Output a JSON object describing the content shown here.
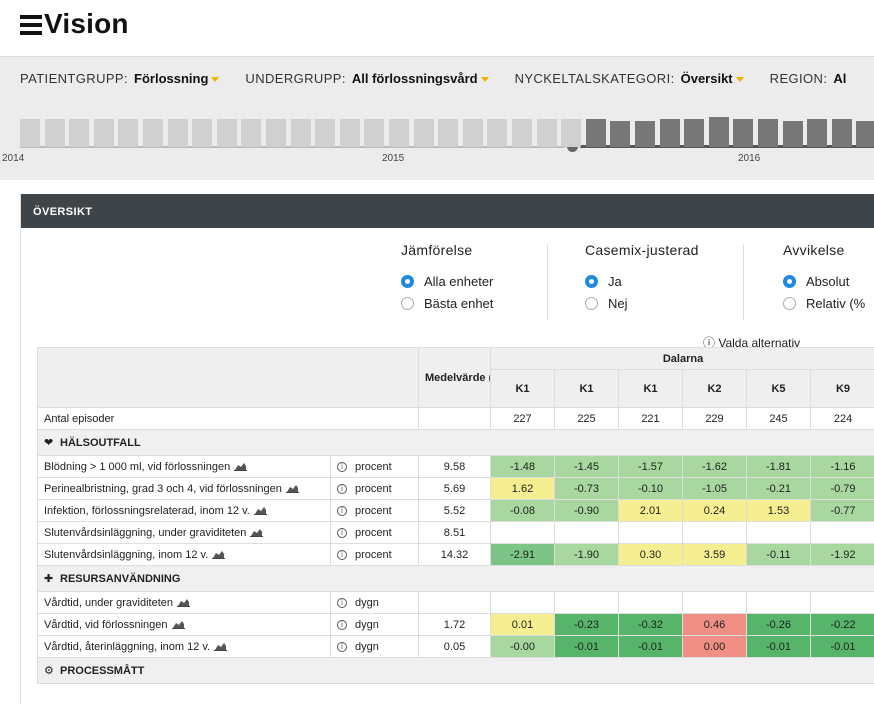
{
  "app": {
    "title": "Vision"
  },
  "filters": [
    {
      "label": "PATIENTGRUPP:",
      "value": "Förlossning"
    },
    {
      "label": "UNDERGRUPP:",
      "value": "All förlossningsvård"
    },
    {
      "label": "NYCKELTALSKATEGORI:",
      "value": "Översikt"
    },
    {
      "label": "REGION:",
      "value": "Al"
    }
  ],
  "timeline": {
    "years": [
      "2014",
      "2015",
      "2016"
    ]
  },
  "panel": {
    "title": "ÖVERSIKT"
  },
  "options": {
    "jamforelse": {
      "title": "Jämförelse",
      "items": [
        {
          "label": "Alla enheter",
          "selected": true
        },
        {
          "label": "Bästa enhet",
          "selected": false
        }
      ]
    },
    "casemix": {
      "title": "Casemix-justerad",
      "items": [
        {
          "label": "Ja",
          "selected": true
        },
        {
          "label": "Nej",
          "selected": false
        }
      ]
    },
    "avvikelse": {
      "title": "Avvikelse",
      "items": [
        {
          "label": "Absolut",
          "selected": true
        },
        {
          "label": "Relativ (%",
          "selected": false
        }
      ]
    },
    "valda": "ⓘ Valda alternativ"
  },
  "table": {
    "mean_header": "Medelvärde (alla enheter)",
    "group_header": "Dalarna",
    "columns": [
      "K1",
      "K1",
      "K1",
      "K2",
      "K5",
      "K9"
    ],
    "episodes": {
      "label": "Antal episoder",
      "values": [
        "227",
        "225",
        "221",
        "229",
        "245",
        "224"
      ]
    },
    "sections": [
      {
        "title": "HÄLSOUTFALL",
        "icon": "heart-icon",
        "rows": [
          {
            "name": "Blödning > 1 000 ml, vid förlossningen",
            "unit": "procent",
            "mean": "9.58",
            "values": [
              "-1.48",
              "-1.45",
              "-1.57",
              "-1.62",
              "-1.81",
              "-1.16"
            ],
            "colors": [
              "g1",
              "g1",
              "g1",
              "g1",
              "g1",
              "g1"
            ]
          },
          {
            "name": "Perinealbristning, grad 3 och 4, vid förlossningen",
            "unit": "procent",
            "mean": "5.69",
            "values": [
              "1.62",
              "-0.73",
              "-0.10",
              "-1.05",
              "-0.21",
              "-0.79"
            ],
            "colors": [
              "y",
              "g1",
              "g1",
              "g1",
              "g1",
              "g1"
            ]
          },
          {
            "name": "Infektion, förlossningsrelaterad, inom 12 v.",
            "unit": "procent",
            "mean": "5.52",
            "values": [
              "-0.08",
              "-0.90",
              "2.01",
              "0.24",
              "1.53",
              "-0.77"
            ],
            "colors": [
              "g1",
              "g1",
              "y",
              "y",
              "y",
              "g1"
            ]
          },
          {
            "name": "Slutenvårdsinläggning, under graviditeten",
            "unit": "procent",
            "mean": "8.51",
            "values": [
              "",
              "",
              "",
              "",
              "",
              ""
            ],
            "colors": [
              "",
              "",
              "",
              "",
              "",
              ""
            ]
          },
          {
            "name": "Slutenvårdsinläggning, inom 12 v.",
            "unit": "procent",
            "mean": "14.32",
            "values": [
              "-2.91",
              "-1.90",
              "0.30",
              "3.59",
              "-0.11",
              "-1.92"
            ],
            "colors": [
              "g2",
              "g1",
              "y",
              "y",
              "g1",
              "g1"
            ]
          }
        ]
      },
      {
        "title": "RESURSANVÄNDNING",
        "icon": "puzzle-icon",
        "rows": [
          {
            "name": "Vårdtid, under graviditeten",
            "unit": "dygn",
            "mean": "",
            "values": [
              "",
              "",
              "",
              "",
              "",
              ""
            ],
            "colors": [
              "",
              "",
              "",
              "",
              "",
              ""
            ]
          },
          {
            "name": "Vårdtid, vid förlossningen",
            "unit": "dygn",
            "mean": "1.72",
            "values": [
              "0.01",
              "-0.23",
              "-0.32",
              "0.46",
              "-0.26",
              "-0.22"
            ],
            "colors": [
              "y",
              "g3",
              "g3",
              "r",
              "g3",
              "g3"
            ]
          },
          {
            "name": "Vårdtid, återinläggning, inom 12 v.",
            "unit": "dygn",
            "mean": "0.05",
            "values": [
              "-0.00",
              "-0.01",
              "-0.01",
              "0.00",
              "-0.01",
              "-0.01"
            ],
            "colors": [
              "g1",
              "g3",
              "g3",
              "r",
              "g3",
              "g3"
            ]
          }
        ]
      },
      {
        "title": "PROCESSMÅTT",
        "icon": "gear-icon",
        "rows": []
      }
    ]
  }
}
